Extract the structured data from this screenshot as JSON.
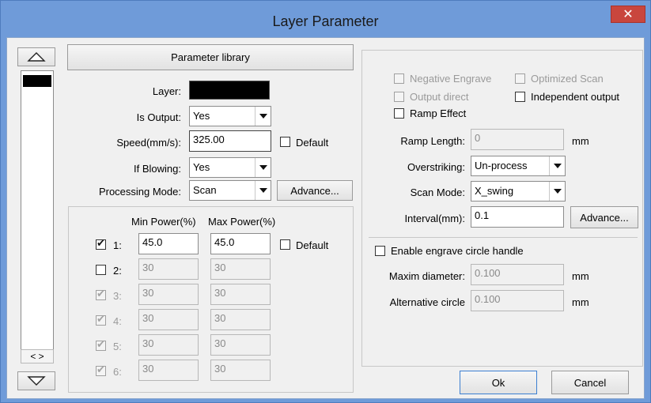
{
  "window": {
    "title": "Layer Parameter",
    "close_glyph": "✕"
  },
  "left": {
    "scroll_arrows": "< >"
  },
  "top_left": {
    "library_button": "Parameter library",
    "layer_label": "Layer:",
    "is_output_label": "Is Output:",
    "is_output_value": "Yes",
    "speed_label": "Speed(mm/s):",
    "speed_value": "325.00",
    "speed_default_label": "Default",
    "blowing_label": "If Blowing:",
    "blowing_value": "Yes",
    "mode_label": "Processing Mode:",
    "mode_value": "Scan",
    "advance_button": "Advance...",
    "layer_color": "#000000"
  },
  "power": {
    "min_header": "Min Power(%)",
    "max_header": "Max Power(%)",
    "default_label": "Default",
    "rows": [
      {
        "label": "1:",
        "min": "45.0",
        "max": "45.0"
      },
      {
        "label": "2:",
        "min": "30",
        "max": "30"
      },
      {
        "label": "3:",
        "min": "30",
        "max": "30"
      },
      {
        "label": "4:",
        "min": "30",
        "max": "30"
      },
      {
        "label": "5:",
        "min": "30",
        "max": "30"
      },
      {
        "label": "6:",
        "min": "30",
        "max": "30"
      }
    ]
  },
  "right": {
    "negative_engrave": "Negative Engrave",
    "optimized_scan": "Optimized Scan",
    "output_direct": "Output direct",
    "independent_output": "Independent output",
    "ramp_effect": "Ramp Effect",
    "ramp_length_label": "Ramp Length:",
    "ramp_length_value": "0",
    "mm1": "mm",
    "overstriking_label": "Overstriking:",
    "overstriking_value": "Un-process",
    "scan_mode_label": "Scan Mode:",
    "scan_mode_value": "X_swing",
    "interval_label": "Interval(mm):",
    "interval_value": "0.1",
    "advance_button": "Advance...",
    "circle_handle": "Enable engrave circle handle",
    "maxim_label": "Maxim diameter:",
    "maxim_value": "0.100",
    "mm2": "mm",
    "alt_label": "Alternative circle",
    "alt_value": "0.100",
    "mm3": "mm"
  },
  "footer": {
    "ok": "Ok",
    "cancel": "Cancel"
  }
}
